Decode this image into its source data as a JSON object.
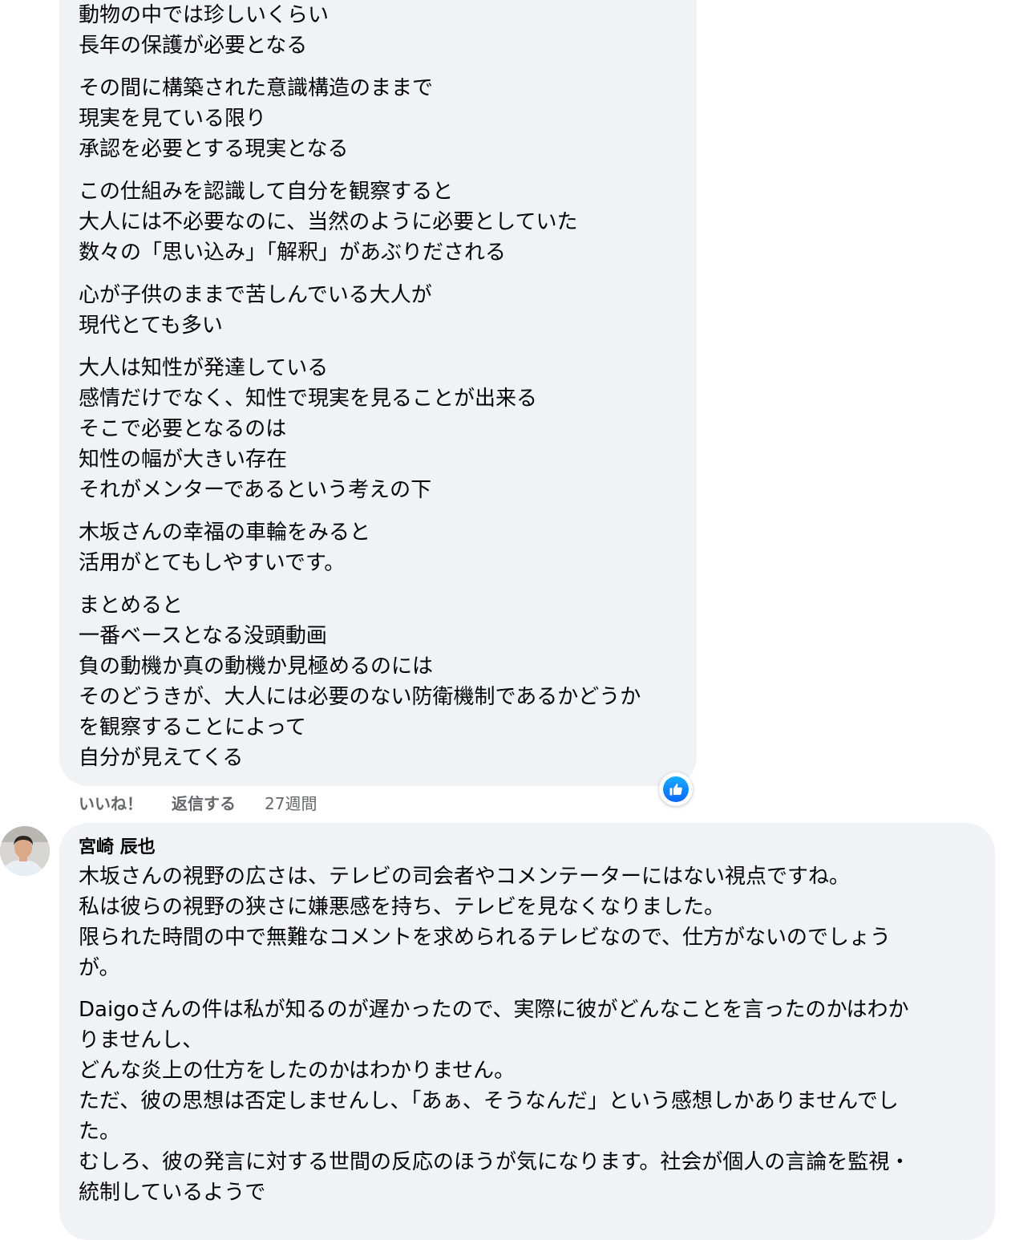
{
  "comment1": {
    "paragraphs": [
      [
        "動物の中では珍しいくらい",
        "長年の保護が必要となる"
      ],
      [
        "その間に構築された意識構造のままで",
        "現実を見ている限り",
        "承認を必要とする現実となる"
      ],
      [
        "この仕組みを認識して自分を観察すると",
        "大人には不必要なのに、当然のように必要としていた",
        "数々の「思い込み」「解釈」があぶりだされる"
      ],
      [
        "心が子供のままで苦しんでいる大人が",
        "現代とても多い"
      ],
      [
        "大人は知性が発達している",
        "感情だけでなく、知性で現実を見ることが出来る",
        "そこで必要となるのは",
        "知性の幅が大きい存在",
        "それがメンターであるという考えの下"
      ],
      [
        "木坂さんの幸福の車輪をみると",
        "活用がとてもしやすいです。"
      ],
      [
        "まとめると",
        "一番ベースとなる没頭動画",
        "負の動機か真の動機か見極めるのには",
        "そのどうきが、大人には必要のない防衛機制であるかどうか",
        "を観察することによって",
        "自分が見えてくる"
      ]
    ],
    "actions": {
      "like": "いいね！",
      "reply": "返信する",
      "time": "27週間"
    },
    "reaction_icon": "thumbs-up-icon",
    "reaction_color": "#0866ff"
  },
  "comment2": {
    "author": "宮崎 辰也",
    "paragraphs": [
      [
        "木坂さんの視野の広さは、テレビの司会者やコメンテーターにはない視点ですね。",
        "私は彼らの視野の狭さに嫌悪感を持ち、テレビを見なくなりました。",
        "限られた時間の中で無難なコメントを求められるテレビなので、仕方がないのでしょう",
        "が。"
      ],
      [
        "Daigoさんの件は私が知るのが遅かったので、実際に彼がどんなことを言ったのかはわか",
        "りませんし、",
        "どんな炎上の仕方をしたのかはわかりません。",
        "ただ、彼の思想は否定しませんし、「あぁ、そうなんだ」という感想しかありませんでし",
        "た。",
        "むしろ、彼の発言に対する世間の反応のほうが気になります。社会が個人の言論を監視・",
        "統制しているようで"
      ]
    ]
  },
  "colors": {
    "bubble": "#f0f2f5",
    "text": "#050505",
    "meta": "#65676b"
  }
}
